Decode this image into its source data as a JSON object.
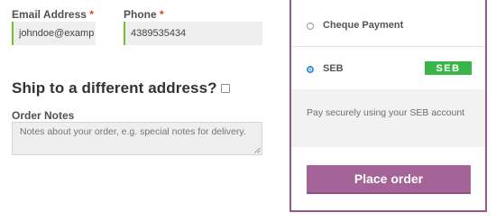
{
  "billing": {
    "email": {
      "label": "Email Address",
      "required_mark": "*",
      "value": "johndoe@examp"
    },
    "phone": {
      "label": "Phone",
      "required_mark": "*",
      "value": "4389535434"
    }
  },
  "shipping": {
    "title": "Ship to a different address?",
    "checked": false
  },
  "order_notes": {
    "label": "Order Notes",
    "placeholder": "Notes about your order, e.g. special notes for delivery."
  },
  "payment": {
    "methods": [
      {
        "label": "Cheque Payment",
        "selected": false
      },
      {
        "label": "SEB",
        "selected": true,
        "logo_text": "SEB"
      }
    ],
    "description": "Pay securely using your SEB account",
    "place_order_label": "Place order"
  },
  "colors": {
    "accent": "#96588a",
    "button": "#a46497",
    "required": "#e2401c",
    "field_focus": "#6dc22e",
    "seb_green": "#3ab54a",
    "radio_selected": "#3b8de0"
  }
}
